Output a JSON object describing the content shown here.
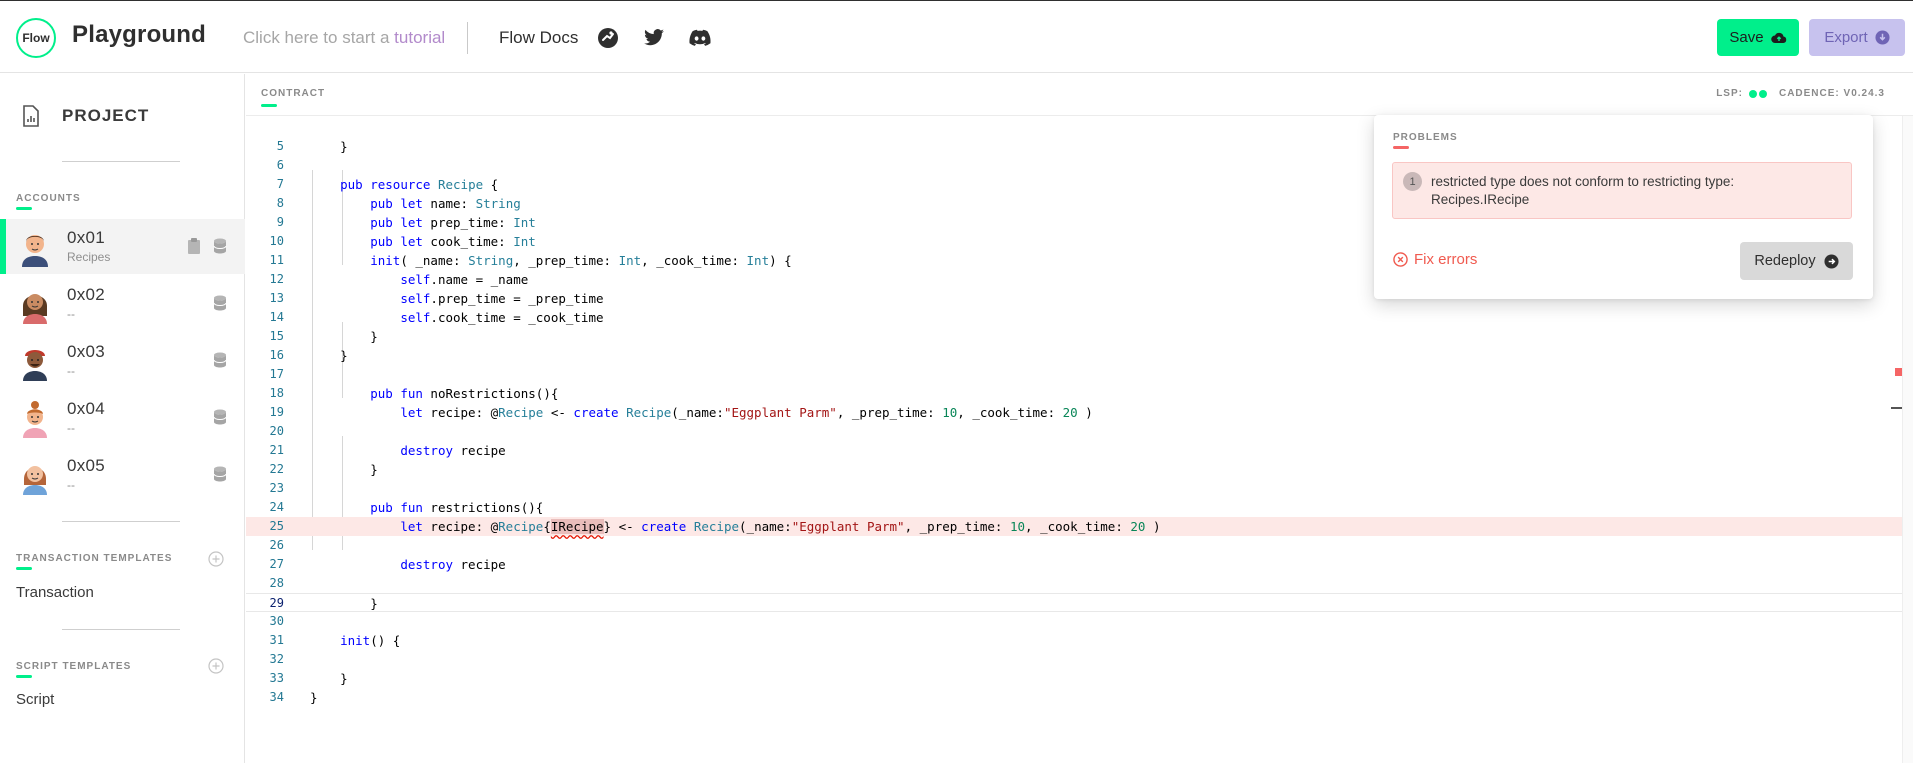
{
  "header": {
    "logo_text": "Flow",
    "app_title": "Playground",
    "tutorial_prefix": "Click here to start a ",
    "tutorial_highlight": "tutorial",
    "docs_label": "Flow Docs",
    "icons": [
      "flow-runner-icon",
      "twitter-icon",
      "discord-icon"
    ],
    "save_label": "Save",
    "export_label": "Export"
  },
  "sidebar": {
    "project_label": "PROJECT",
    "accounts_label": "ACCOUNTS",
    "accounts": [
      {
        "address": "0x01",
        "subtitle": "Recipes",
        "active": true
      },
      {
        "address": "0x02",
        "subtitle": "--",
        "active": false
      },
      {
        "address": "0x03",
        "subtitle": "--",
        "active": false
      },
      {
        "address": "0x04",
        "subtitle": "--",
        "active": false
      },
      {
        "address": "0x05",
        "subtitle": "--",
        "active": false
      }
    ],
    "transaction_templates_label": "TRANSACTION TEMPLATES",
    "transaction_item": "Transaction",
    "script_templates_label": "SCRIPT TEMPLATES",
    "script_item": "Script"
  },
  "editor": {
    "tab_label": "CONTRACT",
    "lsp_label": "LSP:",
    "cadence_label": "CADENCE: V0.24.3",
    "current_line": 29,
    "error_line": 25,
    "lines": [
      {
        "n": "5",
        "code": "    }"
      },
      {
        "n": "6",
        "code": ""
      },
      {
        "n": "7",
        "code": "    pub resource Recipe {"
      },
      {
        "n": "8",
        "code": "        pub let name: String"
      },
      {
        "n": "9",
        "code": "        pub let prep_time: Int"
      },
      {
        "n": "10",
        "code": "        pub let cook_time: Int"
      },
      {
        "n": "11",
        "code": "        init( _name: String, _prep_time: Int, _cook_time: Int) {"
      },
      {
        "n": "12",
        "code": "            self.name = _name"
      },
      {
        "n": "13",
        "code": "            self.prep_time = _prep_time"
      },
      {
        "n": "14",
        "code": "            self.cook_time = _cook_time"
      },
      {
        "n": "15",
        "code": "        }"
      },
      {
        "n": "16",
        "code": "    }"
      },
      {
        "n": "17",
        "code": ""
      },
      {
        "n": "18",
        "code": "        pub fun noRestrictions(){"
      },
      {
        "n": "19",
        "code": "            let recipe: @Recipe <- create Recipe(_name:\"Eggplant Parm\", _prep_time: 10, _cook_time: 20 )"
      },
      {
        "n": "20",
        "code": ""
      },
      {
        "n": "21",
        "code": "            destroy recipe"
      },
      {
        "n": "22",
        "code": "        }"
      },
      {
        "n": "23",
        "code": ""
      },
      {
        "n": "24",
        "code": "        pub fun restrictions(){"
      },
      {
        "n": "25",
        "code": "            let recipe: @Recipe{IRecipe} <- create Recipe(_name:\"Eggplant Parm\", _prep_time: 10, _cook_time: 20 )"
      },
      {
        "n": "26",
        "code": ""
      },
      {
        "n": "27",
        "code": "            destroy recipe"
      },
      {
        "n": "28",
        "code": ""
      },
      {
        "n": "29",
        "code": "        }"
      },
      {
        "n": "30",
        "code": ""
      },
      {
        "n": "31",
        "code": "    init() {"
      },
      {
        "n": "32",
        "code": ""
      },
      {
        "n": "33",
        "code": "    }"
      },
      {
        "n": "34",
        "code": "}"
      }
    ]
  },
  "problems": {
    "title": "PROBLEMS",
    "items": [
      {
        "index": "1",
        "message": "restricted type does not conform to restricting type: Recipes.IRecipe"
      }
    ],
    "fix_label": "Fix errors",
    "redeploy_label": "Redeploy"
  },
  "colors": {
    "accent_green": "#00ef8b",
    "export_bg": "#c7c2ee",
    "error_red": "#f05a4f",
    "error_bg": "#fde8e6"
  }
}
